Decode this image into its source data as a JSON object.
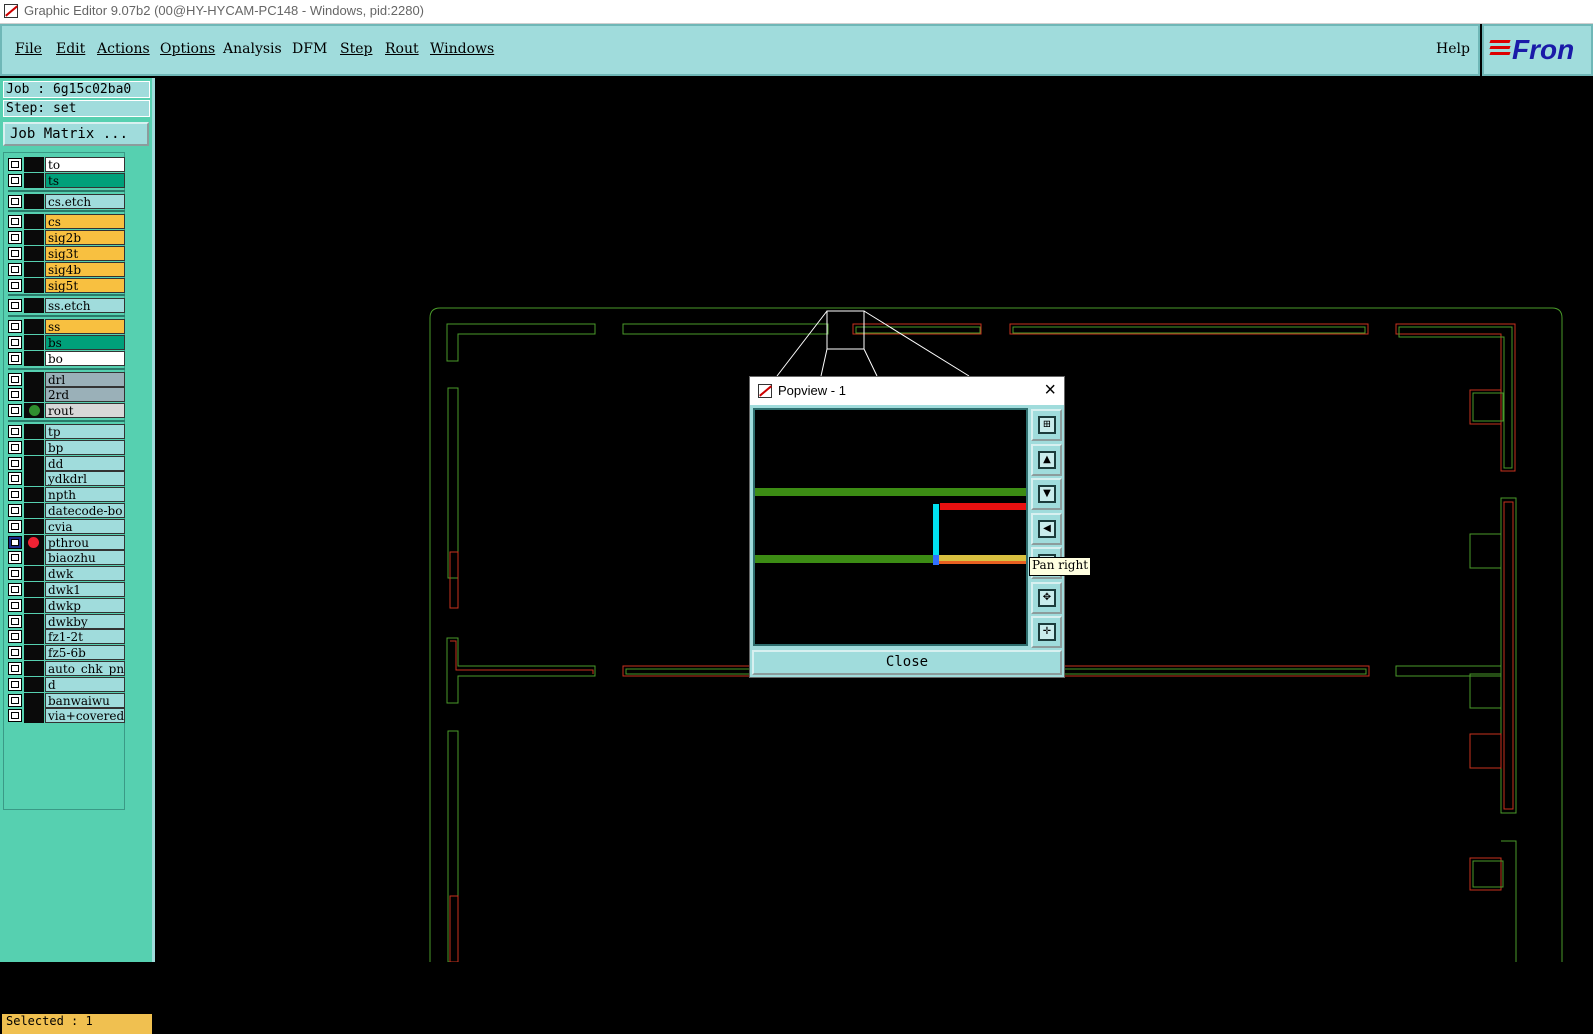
{
  "window": {
    "title": "Graphic Editor 9.07b2 (00@HY-HYCAM-PC148 - Windows, pid:2280)"
  },
  "menubar": {
    "items": [
      {
        "label": "File"
      },
      {
        "label": "Edit"
      },
      {
        "label": "Actions"
      },
      {
        "label": "Options"
      },
      {
        "label": "Analysis"
      },
      {
        "label": "DFM"
      },
      {
        "label": "Step"
      },
      {
        "label": "Rout"
      },
      {
        "label": "Windows"
      }
    ],
    "help": "Help"
  },
  "logo": {
    "text": "Fron"
  },
  "panel": {
    "job": "Job : 6g15c02ba0",
    "step": "Step: set",
    "job_matrix": "Job Matrix ...",
    "selected": "Selected : 1"
  },
  "layers": [
    {
      "name": "to",
      "color": "#ffffff"
    },
    {
      "name": "ts",
      "color": "#00a07a"
    },
    {
      "name": "cs.etch",
      "color": "#a0dcdc"
    },
    {
      "name": "cs",
      "color": "#f8c040"
    },
    {
      "name": "sig2b",
      "color": "#f8c040"
    },
    {
      "name": "sig3t",
      "color": "#f8c040"
    },
    {
      "name": "sig4b",
      "color": "#f8c040"
    },
    {
      "name": "sig5t",
      "color": "#f8c040"
    },
    {
      "name": "ss.etch",
      "color": "#a0dcdc"
    },
    {
      "name": "ss",
      "color": "#f8c040"
    },
    {
      "name": "bs",
      "color": "#00a07a"
    },
    {
      "name": "bo",
      "color": "#ffffff"
    },
    {
      "name": "drl",
      "color": "#9ab0b8"
    },
    {
      "name": "2rd",
      "color": "#9ab0b8"
    },
    {
      "name": "rout",
      "color": "#d8d8d8",
      "mark": "dot"
    },
    {
      "name": "tp",
      "color": "#a0dcdc"
    },
    {
      "name": "bp",
      "color": "#a0dcdc"
    },
    {
      "name": "dd",
      "color": "#a0dcdc"
    },
    {
      "name": "ydkdrl",
      "color": "#a0dcdc"
    },
    {
      "name": "npth",
      "color": "#a0dcdc"
    },
    {
      "name": "datecode-bo",
      "color": "#a0dcdc"
    },
    {
      "name": "cvia",
      "color": "#a0dcdc"
    },
    {
      "name": "pthrou",
      "color": "#a0dcdc",
      "mark": "pick",
      "active": true
    },
    {
      "name": "biaozhu",
      "color": "#a0dcdc"
    },
    {
      "name": "dwk",
      "color": "#a0dcdc"
    },
    {
      "name": "dwk1",
      "color": "#a0dcdc"
    },
    {
      "name": "dwkp",
      "color": "#a0dcdc"
    },
    {
      "name": "dwkby",
      "color": "#a0dcdc"
    },
    {
      "name": "fz1-2t",
      "color": "#a0dcdc"
    },
    {
      "name": "fz5-6b",
      "color": "#a0dcdc"
    },
    {
      "name": "auto_chk_pnl",
      "color": "#a0dcdc"
    },
    {
      "name": "d",
      "color": "#a0dcdc"
    },
    {
      "name": "banwaiwu",
      "color": "#a0dcdc"
    },
    {
      "name": "via+covered",
      "color": "#a0dcdc"
    }
  ],
  "popview": {
    "title": "Popview - 1",
    "close_label": "Close",
    "tooltip": "Pan right",
    "tools": [
      {
        "icon": "zoom-box-icon"
      },
      {
        "icon": "pan-up-icon"
      },
      {
        "icon": "pan-down-icon"
      },
      {
        "icon": "pan-left-icon"
      },
      {
        "icon": "pan-right-icon"
      },
      {
        "icon": "zoom-fit-icon"
      },
      {
        "icon": "zoom-center-icon"
      }
    ]
  }
}
